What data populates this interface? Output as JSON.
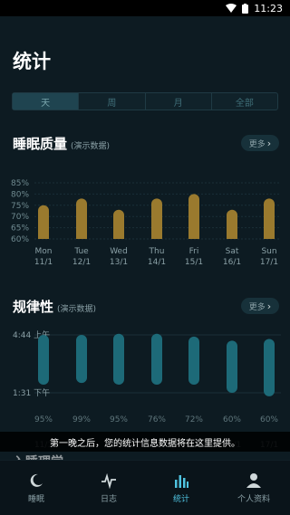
{
  "status": {
    "time": "11:23"
  },
  "page": {
    "title": "统计"
  },
  "tabs": [
    {
      "label": "天",
      "active": true
    },
    {
      "label": "周",
      "active": false
    },
    {
      "label": "月",
      "active": false
    },
    {
      "label": "全部",
      "active": false
    }
  ],
  "quality": {
    "title": "睡眠质量",
    "subtitle": "(演示数据)",
    "more_label": "更多"
  },
  "regularity": {
    "title": "规律性",
    "subtitle": "(演示数据)",
    "more_label": "更多"
  },
  "toast": {
    "text": "第一晚之后，您的统计信息数据将在这里提供。"
  },
  "next_section": {
    "title": "入睡理学"
  },
  "nav": [
    {
      "label": "睡眠",
      "icon": "moon-icon",
      "active": false
    },
    {
      "label": "日志",
      "icon": "pulse-icon",
      "active": false
    },
    {
      "label": "统计",
      "icon": "bar-chart-icon",
      "active": true
    },
    {
      "label": "个人资料",
      "icon": "person-icon",
      "active": false
    }
  ],
  "colors": {
    "quality_bar": "#9a7a2e",
    "regularity_bar": "#1d6a78",
    "accent": "#4fc3e0"
  },
  "chart_data": [
    {
      "type": "bar",
      "categories": [
        "Mon 11/1",
        "Tue 12/1",
        "Wed 13/1",
        "Thu 14/1",
        "Fri 15/1",
        "Sat 16/1",
        "Sun 17/1"
      ],
      "day_labels": [
        "Mon",
        "Tue",
        "Wed",
        "Thu",
        "Fri",
        "Sat",
        "Sun"
      ],
      "date_labels": [
        "11/1",
        "12/1",
        "13/1",
        "14/1",
        "15/1",
        "16/1",
        "17/1"
      ],
      "values": [
        75,
        78,
        73,
        78,
        80,
        73,
        78
      ],
      "yticks": [
        "85%",
        "80%",
        "75%",
        "70%",
        "65%",
        "60%"
      ],
      "ylim": [
        60,
        85
      ]
    },
    {
      "type": "bar",
      "categories": [
        "Mon 11/1",
        "Tue 12/1",
        "Wed 13/1",
        "Thu 14/1",
        "Fri 15/1",
        "Sat 16/1",
        "Sun 17/1"
      ],
      "yticks": [
        "4:44 上午",
        "1:31 下午"
      ],
      "ranges": [
        [
          0.0,
          0.86
        ],
        [
          0.0,
          0.83
        ],
        [
          -0.02,
          0.86
        ],
        [
          -0.02,
          0.86
        ],
        [
          0.03,
          0.86
        ],
        [
          0.1,
          1.0
        ],
        [
          0.07,
          1.06
        ]
      ],
      "percent_labels": [
        "95%",
        "99%",
        "95%",
        "76%",
        "72%",
        "60%",
        "60%"
      ],
      "date_labels": [
        "11/1",
        "12/1",
        "13/1",
        "14/1",
        "15/1",
        "16/1",
        "17/1"
      ]
    }
  ]
}
